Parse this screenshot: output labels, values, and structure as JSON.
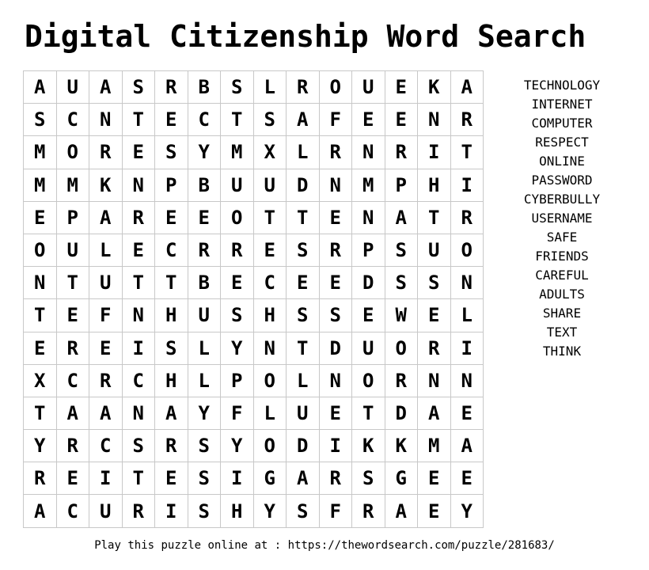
{
  "title": "Digital Citizenship Word Search",
  "grid": [
    [
      "A",
      "U",
      "A",
      "S",
      "R",
      "B",
      "S",
      "L",
      "R",
      "O",
      "U",
      "E",
      "K",
      "A"
    ],
    [
      "S",
      "C",
      "N",
      "T",
      "E",
      "C",
      "T",
      "S",
      "A",
      "F",
      "E",
      "E",
      "N",
      "R"
    ],
    [
      "M",
      "O",
      "R",
      "E",
      "S",
      "Y",
      "M",
      "X",
      "L",
      "R",
      "N",
      "R",
      "I",
      "T"
    ],
    [
      "M",
      "M",
      "K",
      "N",
      "P",
      "B",
      "U",
      "U",
      "D",
      "N",
      "M",
      "P",
      "H",
      "I"
    ],
    [
      "E",
      "P",
      "A",
      "R",
      "E",
      "E",
      "O",
      "T",
      "T",
      "E",
      "N",
      "A",
      "T",
      "R"
    ],
    [
      "O",
      "U",
      "L",
      "E",
      "C",
      "R",
      "R",
      "E",
      "S",
      "R",
      "P",
      "S",
      "U",
      "O"
    ],
    [
      "N",
      "T",
      "U",
      "T",
      "T",
      "B",
      "E",
      "C",
      "E",
      "E",
      "D",
      "S",
      "S",
      "N"
    ],
    [
      "T",
      "E",
      "F",
      "N",
      "H",
      "U",
      "S",
      "H",
      "S",
      "S",
      "E",
      "W",
      "E",
      "L"
    ],
    [
      "E",
      "R",
      "E",
      "I",
      "S",
      "L",
      "Y",
      "N",
      "T",
      "D",
      "U",
      "O",
      "R",
      "I"
    ],
    [
      "X",
      "C",
      "R",
      "C",
      "H",
      "L",
      "P",
      "O",
      "L",
      "N",
      "O",
      "R",
      "N",
      "N"
    ],
    [
      "T",
      "A",
      "A",
      "N",
      "A",
      "Y",
      "F",
      "L",
      "U",
      "E",
      "T",
      "D",
      "A",
      "E"
    ],
    [
      "Y",
      "R",
      "C",
      "S",
      "R",
      "S",
      "Y",
      "O",
      "D",
      "I",
      "K",
      "K",
      "M",
      "A"
    ],
    [
      "R",
      "E",
      "I",
      "T",
      "E",
      "S",
      "I",
      "G",
      "A",
      "R",
      "S",
      "G",
      "E",
      "E"
    ],
    [
      "A",
      "C",
      "U",
      "R",
      "I",
      "S",
      "H",
      "Y",
      "S",
      "F",
      "R",
      "A",
      "E",
      "Y"
    ]
  ],
  "words": [
    "TECHNOLOGY",
    "INTERNET",
    "COMPUTER",
    "RESPECT",
    "ONLINE",
    "PASSWORD",
    "CYBERBULLY",
    "USERNAME",
    "SAFE",
    "FRIENDS",
    "CAREFUL",
    "ADULTS",
    "SHARE",
    "TEXT",
    "THINK"
  ],
  "footer": "Play this puzzle online at : https://thewordsearch.com/puzzle/281683/"
}
